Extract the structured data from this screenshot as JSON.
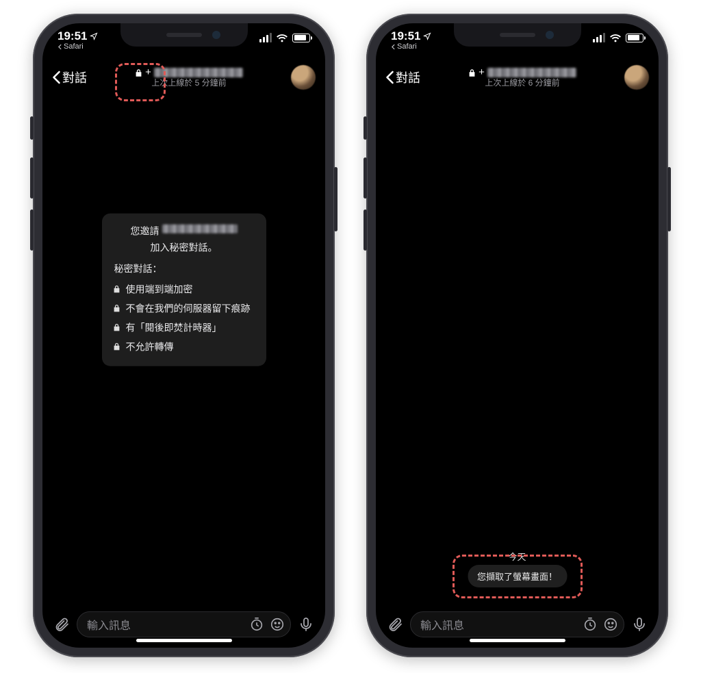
{
  "phones": {
    "left": {
      "status": {
        "time": "19:51",
        "back_app": "Safari"
      },
      "nav": {
        "back_label": "對話",
        "contact_prefix": "+",
        "subtitle": "上次上線於 5 分鐘前"
      },
      "info_card": {
        "lead_pre": "您邀請",
        "lead_post": "加入秘密對話。",
        "section_title": "秘密對話：",
        "bullets": [
          "使用端到端加密",
          "不會在我們的伺服器留下痕跡",
          "有「閱後即焚計時器」",
          "不允許轉傳"
        ]
      },
      "input": {
        "placeholder": "輸入訊息"
      }
    },
    "right": {
      "status": {
        "time": "19:51",
        "back_app": "Safari"
      },
      "nav": {
        "back_label": "對話",
        "contact_prefix": "+",
        "subtitle": "上次上線於 6 分鐘前"
      },
      "day_label": "今天",
      "pill_text": "您擷取了螢幕畫面！",
      "input": {
        "placeholder": "輸入訊息"
      }
    }
  },
  "icons": {
    "location": "location-arrow-icon",
    "signal": "cellular-signal-icon",
    "wifi": "wifi-icon",
    "battery": "battery-icon",
    "chevron_left": "chevron-left-icon",
    "lock": "lock-icon",
    "attach": "paperclip-icon",
    "timer": "timer-icon",
    "sticker": "sticker-icon",
    "mic": "microphone-icon"
  },
  "colors": {
    "annotation": "#e05a57",
    "card_bg": "#1e1e1e",
    "text_secondary": "#9a9aa0"
  }
}
